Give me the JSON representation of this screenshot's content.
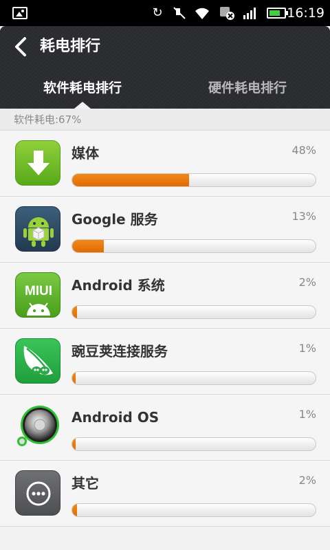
{
  "status_bar": {
    "time": "16:19",
    "icons": [
      "picture-icon",
      "sync-icon",
      "mute-icon",
      "wifi-icon",
      "notification-icon",
      "signal-icon",
      "battery-icon"
    ]
  },
  "header": {
    "title": "耗电排行",
    "tabs": [
      {
        "label": "软件耗电排行",
        "active": true
      },
      {
        "label": "硬件耗电排行",
        "active": false
      }
    ]
  },
  "summary": {
    "text": "软件耗电:67%"
  },
  "items": [
    {
      "name": "媒体",
      "percent_label": "48%",
      "percent": 48,
      "icon": "download-icon"
    },
    {
      "name": "Google 服务",
      "percent_label": "13%",
      "percent": 13,
      "icon": "android-box-icon"
    },
    {
      "name": "Android 系统",
      "percent_label": "2%",
      "percent": 2,
      "icon": "miui-icon"
    },
    {
      "name": "豌豆荚连接服务",
      "percent_label": "1%",
      "percent": 1,
      "icon": "pea-icon"
    },
    {
      "name": "Android OS",
      "percent_label": "1%",
      "percent": 1,
      "icon": "os-disc-icon"
    },
    {
      "name": "其它",
      "percent_label": "2%",
      "percent": 2,
      "icon": "more-icon"
    }
  ],
  "colors": {
    "accent": "#e97800",
    "header_bg": "#2b2d31",
    "tab_inactive": "#b9b9b9"
  }
}
